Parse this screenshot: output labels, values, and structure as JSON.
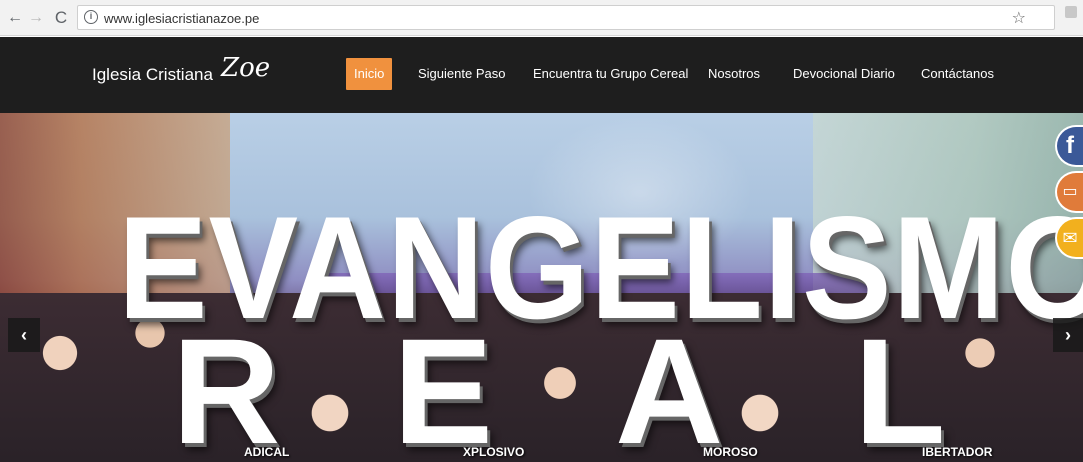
{
  "browser": {
    "back_icon": "←",
    "forward_icon": "→",
    "reload_icon": "C",
    "info_icon": "i",
    "url": "www.iglesiacristianazoe.pe",
    "star_icon": "☆"
  },
  "header": {
    "logo_text": "Iglesia Cristiana",
    "logo_script": "Zoe",
    "menu": [
      {
        "label": "Inicio",
        "active": true
      },
      {
        "label": "Siguiente Paso"
      },
      {
        "label": "Encuentra tu Grupo Cereal"
      },
      {
        "label": "Nosotros"
      },
      {
        "label": "Devocional Diario"
      },
      {
        "label": "Contáctanos"
      }
    ]
  },
  "hero": {
    "headline": "EVANGELISMO",
    "acronym": [
      {
        "letter": "R",
        "rest": "ADICAL"
      },
      {
        "letter": "E",
        "rest": "XPLOSIVO"
      },
      {
        "letter": "A",
        "rest": "MOROSO"
      },
      {
        "letter": "L",
        "rest": "IBERTADOR"
      }
    ],
    "prev_icon": "‹",
    "next_icon": "›"
  },
  "social": {
    "facebook_glyph": "f",
    "devices_glyph": "▭",
    "mail_glyph": "✉"
  },
  "colors": {
    "accent": "#f0913e",
    "header_bg": "#1e1e1e",
    "facebook": "#3b5998",
    "mail": "#f2b01e"
  }
}
